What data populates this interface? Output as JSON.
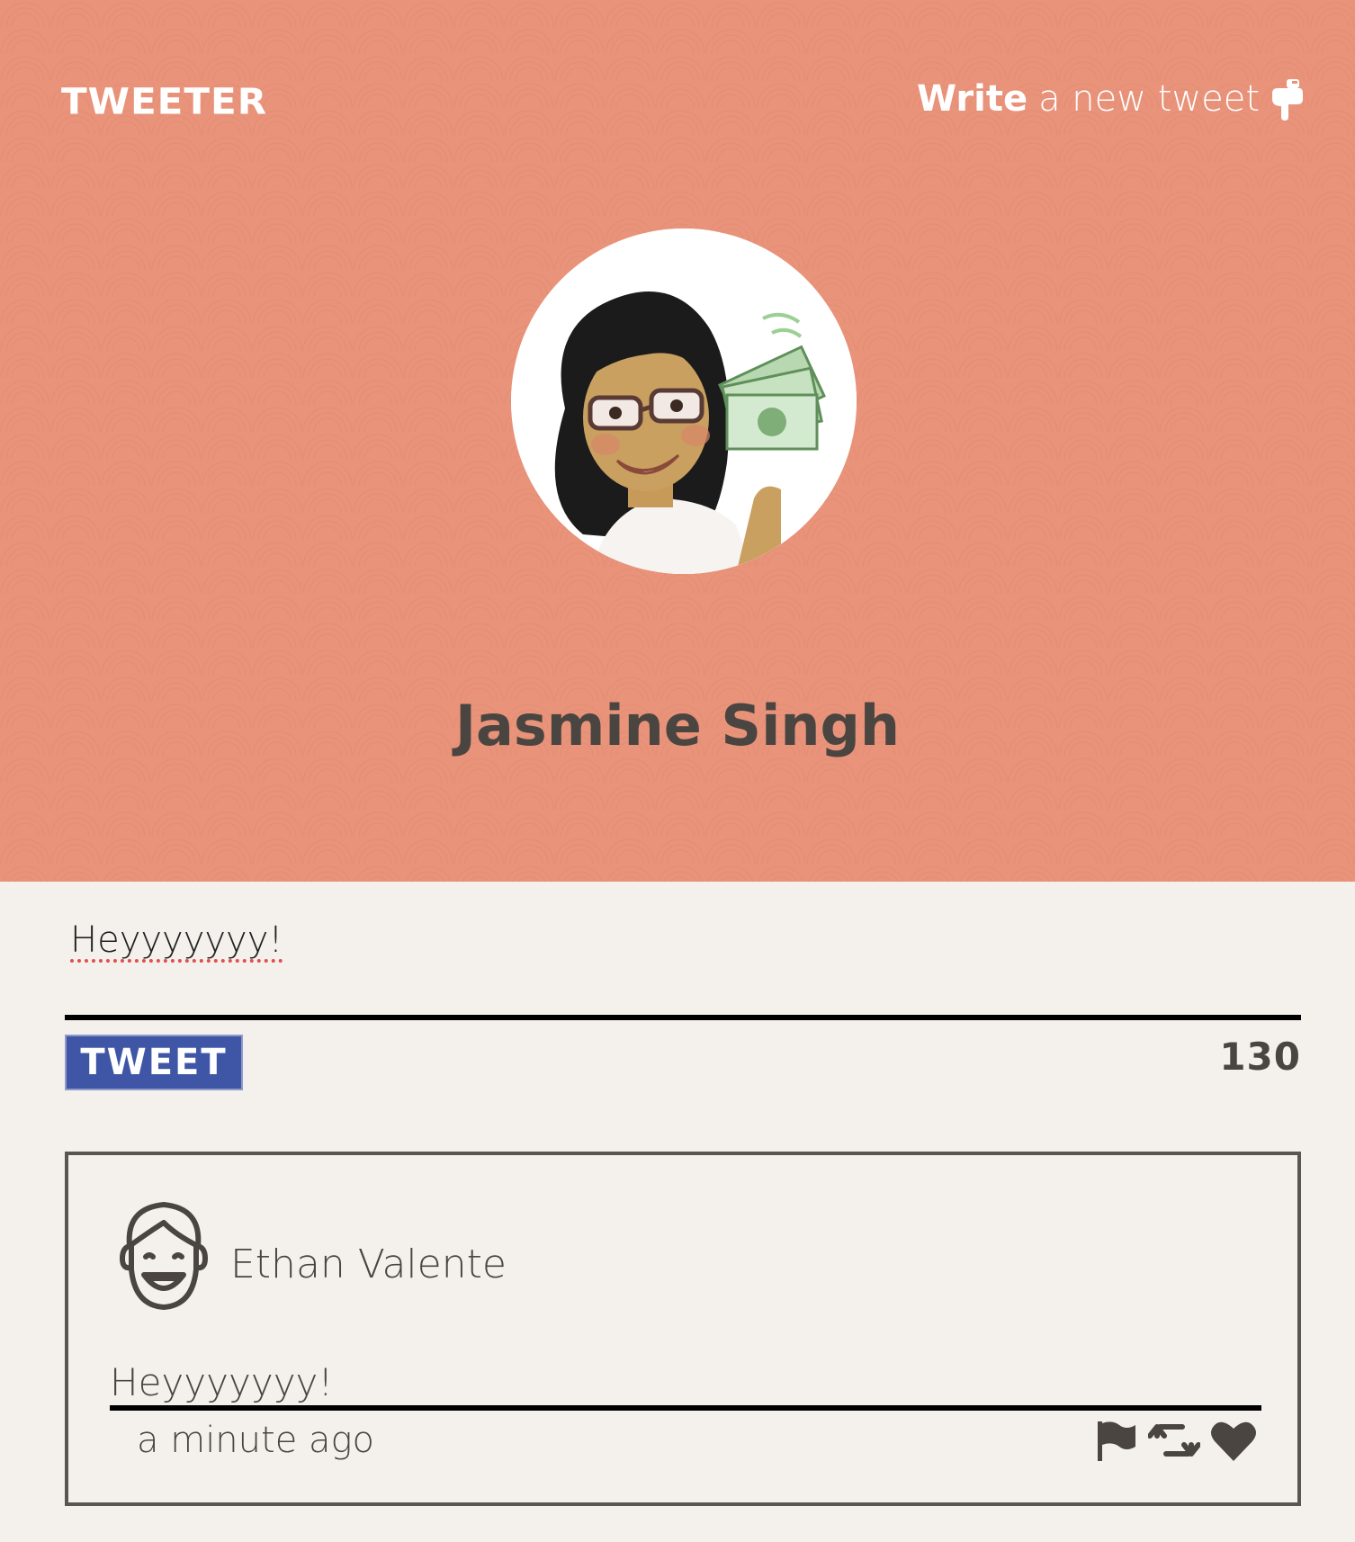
{
  "nav": {
    "brand": "TWEETER",
    "write_strong": "Write",
    "write_rest": "a new tweet",
    "hand_icon": "pointing-hand-icon"
  },
  "profile": {
    "name": "Jasmine Singh",
    "avatar_icon": "bitmoji-avatar"
  },
  "composer": {
    "text": "Heyyyyyyy!",
    "button_label": "TWEET",
    "counter": "130"
  },
  "tweets": [
    {
      "author": "Ethan Valente",
      "text": "Heyyyyyyy!",
      "time": "a minute ago",
      "actions": [
        "flag-icon",
        "retweet-icon",
        "heart-icon"
      ]
    }
  ],
  "colors": {
    "header_bg": "#e8937a",
    "page_bg": "#f4f1ed",
    "button_bg": "#3f56a6",
    "text_dark": "#4a4540"
  }
}
